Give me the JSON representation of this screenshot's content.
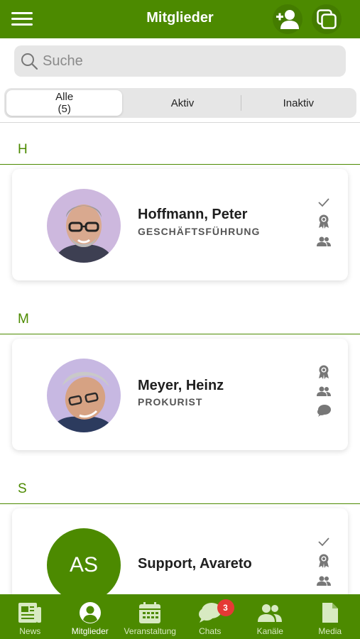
{
  "header": {
    "title": "Mitglieder",
    "menu_icon": "hamburger-menu-icon",
    "add_icon": "add-person-icon",
    "copy_icon": "copy-icon"
  },
  "search": {
    "placeholder": "Suche",
    "value": ""
  },
  "filter": {
    "tabs": [
      {
        "label": "Alle",
        "count": "(5)",
        "active": true
      },
      {
        "label": "Aktiv",
        "count": "",
        "active": false
      },
      {
        "label": "Inaktiv",
        "count": "",
        "active": false
      }
    ]
  },
  "sections": [
    {
      "letter": "H",
      "members": [
        {
          "name": "Hoffmann, Peter",
          "role": "GESCHÄFTSFÜHRUNG",
          "avatar": "photo",
          "icons": [
            "check-icon",
            "award-icon",
            "group-icon"
          ]
        }
      ]
    },
    {
      "letter": "M",
      "members": [
        {
          "name": "Meyer, Heinz",
          "role": "PROKURIST",
          "avatar": "photo",
          "icons": [
            "award-icon",
            "group-icon",
            "chat-icon"
          ]
        }
      ]
    },
    {
      "letter": "S",
      "members": [
        {
          "name": "Support, Avareto",
          "role": "",
          "avatar_initials": "AS",
          "icons": [
            "check-icon",
            "award-icon",
            "group-icon"
          ]
        }
      ]
    }
  ],
  "tabbar": {
    "items": [
      {
        "label": "News",
        "icon": "newspaper-icon",
        "active": false
      },
      {
        "label": "Mitglieder",
        "icon": "person-circle-icon",
        "active": true
      },
      {
        "label": "Veranstaltung",
        "icon": "calendar-icon",
        "active": false
      },
      {
        "label": "Chats",
        "icon": "chat-icon",
        "active": false,
        "badge": "3"
      },
      {
        "label": "Kanäle",
        "icon": "group-icon",
        "active": false
      },
      {
        "label": "Media",
        "icon": "document-icon",
        "active": false
      }
    ]
  },
  "colors": {
    "brand": "#4c8a00",
    "badge": "#e53935"
  }
}
